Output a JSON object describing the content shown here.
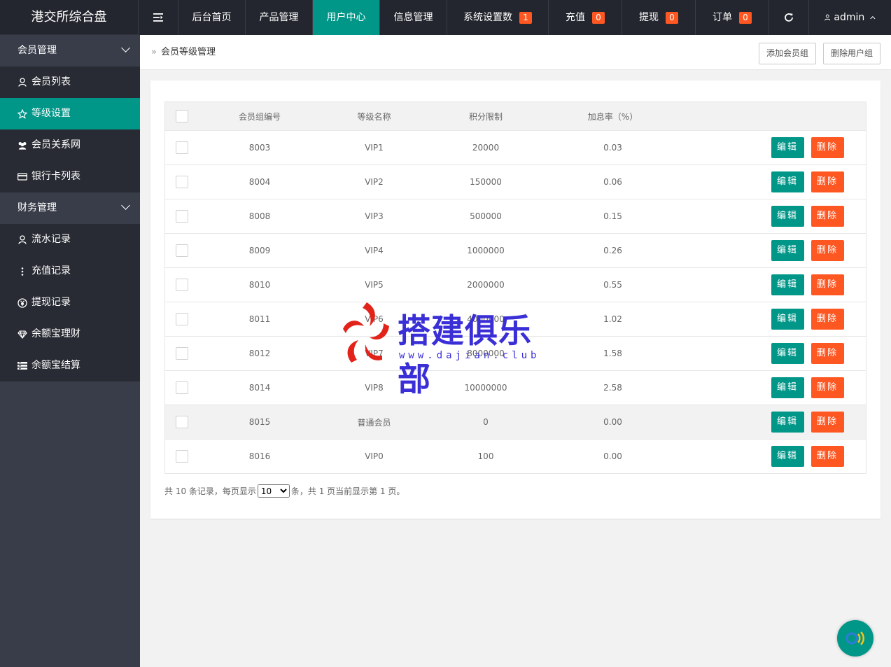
{
  "app": {
    "title": "港交所综合盘"
  },
  "nav": {
    "items": [
      {
        "label": "后台首页"
      },
      {
        "label": "产品管理"
      },
      {
        "label": "用户中心"
      },
      {
        "label": "信息管理"
      },
      {
        "label": "系统设置数",
        "badge": "1"
      },
      {
        "label": "充值",
        "badge": "0"
      },
      {
        "label": "提现",
        "badge": "0"
      },
      {
        "label": "订单",
        "badge": "0"
      }
    ],
    "user": "admin"
  },
  "sidebar": {
    "group1": {
      "label": "会员管理"
    },
    "items1": [
      {
        "label": "会员列表",
        "icon": "user-icon"
      },
      {
        "label": "等级设置",
        "icon": "star-icon"
      },
      {
        "label": "会员关系网",
        "icon": "users-icon"
      },
      {
        "label": "银行卡列表",
        "icon": "credit-card-icon"
      }
    ],
    "group2": {
      "label": "财务管理"
    },
    "items2": [
      {
        "label": "流水记录",
        "icon": "user-icon"
      },
      {
        "label": "充值记录",
        "icon": "more-vertical-icon"
      },
      {
        "label": "提现记录",
        "icon": "yen-icon"
      },
      {
        "label": "余额宝理财",
        "icon": "diamond-icon"
      },
      {
        "label": "余额宝结算",
        "icon": "list-icon"
      }
    ]
  },
  "breadcrumb": {
    "label": "会员等级管理"
  },
  "header_buttons": {
    "add": "添加会员组",
    "delete": "删除用户组"
  },
  "table": {
    "headers": {
      "id": "会员组编号",
      "name": "等级名称",
      "points": "积分限制",
      "rate": "加息率（%）"
    },
    "edit_label": "编辑",
    "delete_label": "删除",
    "rows": [
      {
        "id": "8003",
        "name": "VIP1",
        "points": "20000",
        "rate": "0.03"
      },
      {
        "id": "8004",
        "name": "VIP2",
        "points": "150000",
        "rate": "0.06"
      },
      {
        "id": "8008",
        "name": "VIP3",
        "points": "500000",
        "rate": "0.15"
      },
      {
        "id": "8009",
        "name": "VIP4",
        "points": "1000000",
        "rate": "0.26"
      },
      {
        "id": "8010",
        "name": "VIP5",
        "points": "2000000",
        "rate": "0.55"
      },
      {
        "id": "8011",
        "name": "VIP6",
        "points": "4000000",
        "rate": "1.02"
      },
      {
        "id": "8012",
        "name": "VIP7",
        "points": "8000000",
        "rate": "1.58"
      },
      {
        "id": "8014",
        "name": "VIP8",
        "points": "10000000",
        "rate": "2.58"
      },
      {
        "id": "8015",
        "name": "普通会员",
        "points": "0",
        "rate": "0.00"
      },
      {
        "id": "8016",
        "name": "VIP0",
        "points": "100",
        "rate": "0.00"
      }
    ]
  },
  "pager": {
    "prefix": "共 10 条记录，每页显示",
    "page_size": "10",
    "suffix": "条，共 1 页当前显示第 1 页。"
  },
  "watermark": {
    "title": "搭建俱乐部",
    "url": "www.dajian.club"
  },
  "colors": {
    "accent": "#009688",
    "danger": "#ff5722",
    "topbar": "#23262e",
    "sidebar": "#393d49"
  }
}
